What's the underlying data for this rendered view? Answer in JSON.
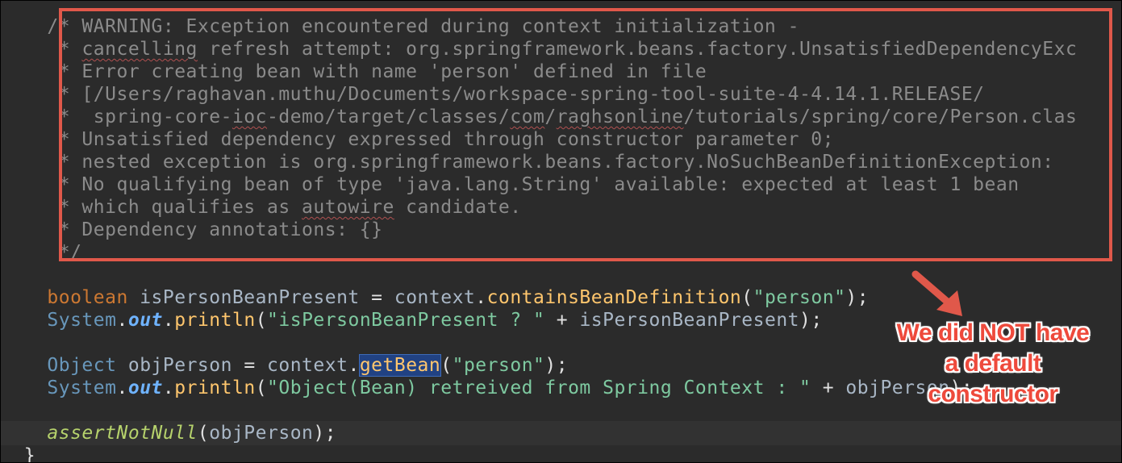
{
  "comment_lines": [
    {
      "parts": [
        {
          "t": "/* WARNING: Exception encountered during context initialization -"
        }
      ]
    },
    {
      "parts": [
        {
          "t": " * "
        },
        {
          "t": "cancelling",
          "typo": true
        },
        {
          "t": " refresh attempt: org.springframework.beans.factory.UnsatisfiedDependencyExc"
        }
      ]
    },
    {
      "parts": [
        {
          "t": " * Error creating bean with name 'person' defined in file"
        }
      ]
    },
    {
      "parts": [
        {
          "t": " * [/Users/raghavan.muthu/Documents/workspace-spring-tool-suite-4-4.14.1.RELEASE/"
        }
      ]
    },
    {
      "parts": [
        {
          "t": " *  spring-core-"
        },
        {
          "t": "ioc",
          "typo": true
        },
        {
          "t": "-demo/target/classes/"
        },
        {
          "t": "com",
          "typo": true
        },
        {
          "t": "/"
        },
        {
          "t": "raghsonline",
          "typo": true
        },
        {
          "t": "/tutorials/spring/core/Person.clas"
        }
      ]
    },
    {
      "parts": [
        {
          "t": " * Unsatisfied dependency expressed through constructor parameter 0;"
        }
      ]
    },
    {
      "parts": [
        {
          "t": " * nested exception is org.springframework.beans.factory.NoSuchBeanDefinitionException:"
        }
      ]
    },
    {
      "parts": [
        {
          "t": " * No qualifying bean of type 'java.lang.String' available: expected at least 1 bean"
        }
      ]
    },
    {
      "parts": [
        {
          "t": " * which qualifies as "
        },
        {
          "t": "autowire",
          "typo": true
        },
        {
          "t": " candidate."
        }
      ]
    },
    {
      "parts": [
        {
          "t": " * Dependency annotations: {}"
        }
      ]
    },
    {
      "parts": [
        {
          "t": " */"
        }
      ]
    }
  ],
  "code": {
    "line1": {
      "type": "boolean",
      "name": "isPersonBeanPresent",
      "eq": " = ",
      "obj": "context",
      "dot": ".",
      "method": "containsBeanDefinition",
      "open": "(",
      "arg": "\"person\"",
      "close": ");"
    },
    "line2": {
      "cls": "System",
      "dot": ".",
      "field": "out",
      "dot2": ".",
      "method": "println",
      "open": "(",
      "str": "\"isPersonBeanPresent ? \"",
      "plus": " + ",
      "var": "isPersonBeanPresent",
      "close": ");"
    },
    "line3": {
      "type": "Object",
      "name": "objPerson",
      "eq": " = ",
      "obj": "context",
      "dot": ".",
      "method": "getBean",
      "open": "(",
      "arg": "\"person\"",
      "close": ");"
    },
    "line4": {
      "cls": "System",
      "dot": ".",
      "field": "out",
      "dot2": ".",
      "method": "println",
      "open": "(",
      "str": "\"Object(Bean) retreived from Spring Context : \"",
      "plus": " + ",
      "var": "objPerson",
      "close": ");"
    },
    "line5": {
      "method": "assertNotNull",
      "open": "(",
      "var": "objPerson",
      "close": ");"
    },
    "line6": {
      "brace": "}"
    }
  },
  "annotation": {
    "lines": [
      "We did NOT have",
      "a default",
      "constructor"
    ],
    "color": "#ee4a3c",
    "box_color": "#e0584a"
  }
}
